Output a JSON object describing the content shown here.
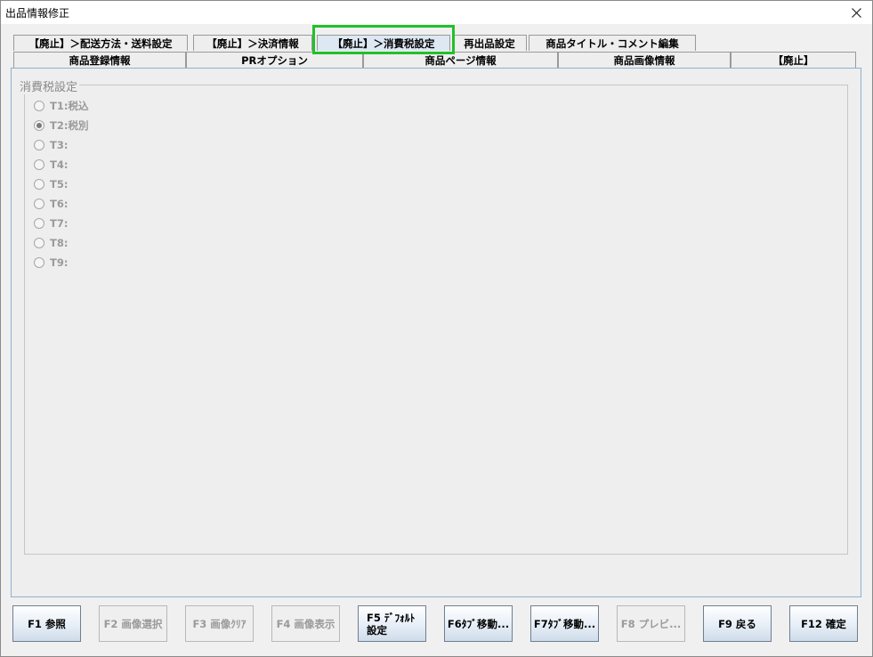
{
  "window": {
    "title": "出品情報修正"
  },
  "tabs_row1": [
    {
      "label": "【廃止】＞配送方法・送料設定"
    },
    {
      "label": "【廃止】＞決済情報"
    },
    {
      "label": "【廃止】＞消費税設定"
    },
    {
      "label": "再出品設定"
    },
    {
      "label": "商品タイトル・コメント編集"
    }
  ],
  "tabs_row2": [
    {
      "label": "商品登録情報"
    },
    {
      "label": "PRオプション"
    },
    {
      "label": "商品ページ情報"
    },
    {
      "label": "商品画像情報"
    },
    {
      "label": "【廃止】"
    }
  ],
  "active_tab": "【廃止】＞消費税設定",
  "tax_group": {
    "title": "消費税設定",
    "options": [
      {
        "label": "T1:税込",
        "selected": false
      },
      {
        "label": "T2:税別",
        "selected": true
      },
      {
        "label": "T3:",
        "selected": false
      },
      {
        "label": "T4:",
        "selected": false
      },
      {
        "label": "T5:",
        "selected": false
      },
      {
        "label": "T6:",
        "selected": false
      },
      {
        "label": "T7:",
        "selected": false
      },
      {
        "label": "T8:",
        "selected": false
      },
      {
        "label": "T9:",
        "selected": false
      }
    ]
  },
  "buttons": [
    {
      "label": "F1 参照",
      "enabled": true
    },
    {
      "label": "F2 画像選択",
      "enabled": false
    },
    {
      "label": "F3 画像ｸﾘｱ",
      "enabled": false
    },
    {
      "label": "F4 画像表示",
      "enabled": false
    },
    {
      "label_line1": "F5 ﾃﾞﾌｫﾙﾄ",
      "label_line2": "設定",
      "enabled": true
    },
    {
      "label": "F6ﾀﾌﾞ移動...",
      "enabled": true
    },
    {
      "label": "F7ﾀﾌﾞ移動...",
      "enabled": true
    },
    {
      "label": "F8 プレビ...",
      "enabled": false
    },
    {
      "label": "F9 戻る",
      "enabled": true
    },
    {
      "label": "F12 確定",
      "enabled": true
    }
  ],
  "colors": {
    "highlight": "#22c02a",
    "panel_border": "#8fb1cf",
    "active_tab": "#dde8f3"
  }
}
